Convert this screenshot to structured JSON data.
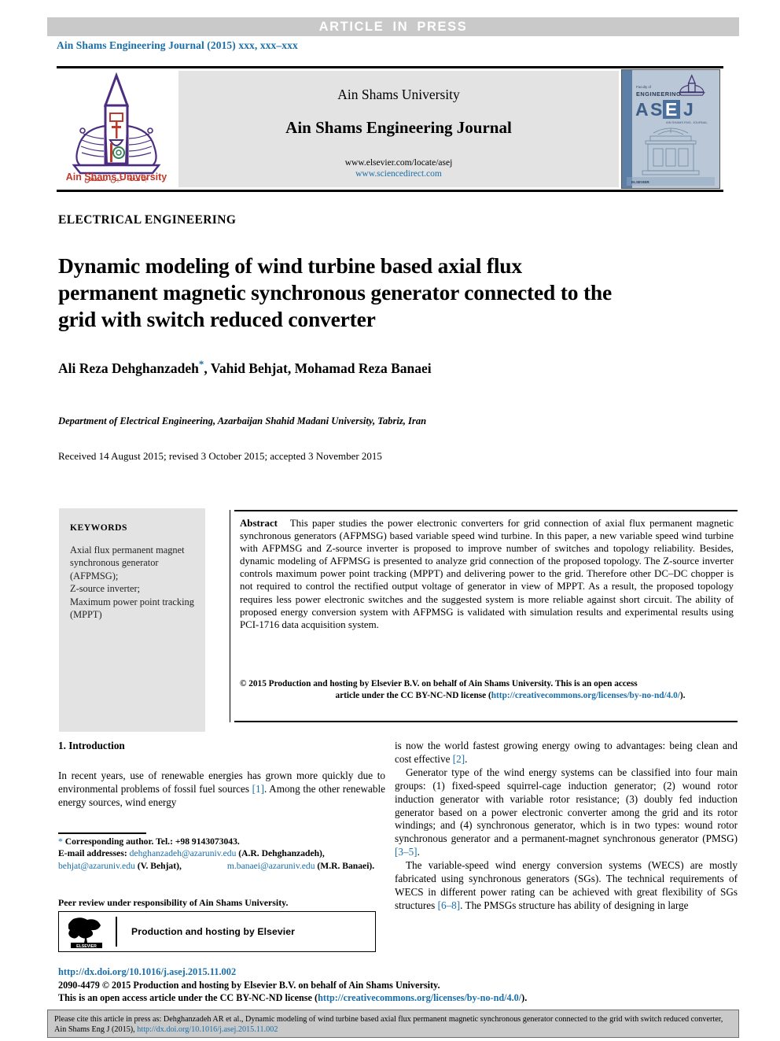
{
  "banner": {
    "article_in_press": "ARTICLE  IN  PRESS"
  },
  "journal_ref": "Ain Shams Engineering Journal (2015) xxx, xxx–xxx",
  "masthead": {
    "university": "Ain Shams University",
    "journal_name": "Ain Shams Engineering Journal",
    "url_elsevier": "www.elsevier.com/locate/asej",
    "url_sciencedirect": "www.sciencedirect.com",
    "logo_alt": "Ain Shams University",
    "logo_label_en": "Ain Shams University",
    "cover_title_small": "Faculty of",
    "cover_title": "ENGINEERING",
    "cover_acronym": "ASEJ",
    "cover_subtitle": "AIN SHAMS ENGINEERING JOURNAL"
  },
  "article": {
    "kicker": "ELECTRICAL ENGINEERING",
    "title": "Dynamic modeling of wind turbine based axial flux permanent magnetic synchronous generator connected to the grid with switch reduced converter",
    "authors": "Ali Reza Dehghanzadeh",
    "authors_rest": ", Vahid Behjat, Mohamad Reza Banaei",
    "corresponding_mark": "*",
    "affiliation": "Department of Electrical Engineering, Azarbaijan Shahid Madani University, Tabriz, Iran",
    "received": "Received 14 August 2015; revised 3 October 2015; accepted 3 November 2015"
  },
  "keywords": {
    "heading": "KEYWORDS",
    "items": [
      "Axial flux permanent magnet synchronous generator (AFPMSG);",
      "Z-source inverter;",
      "Maximum power point tracking (MPPT)"
    ]
  },
  "abstract": {
    "label": "Abstract",
    "text": "This paper studies the power electronic converters for grid connection of axial flux permanent magnetic synchronous generators (AFPMSG) based variable speed wind turbine. In this paper, a new variable speed wind turbine with AFPMSG and Z-source inverter is proposed to improve number of switches and topology reliability. Besides, dynamic modeling of AFPMSG is presented to analyze grid connection of the proposed topology. The Z-source inverter controls maximum power point tracking (MPPT) and delivering power to the grid. Therefore other DC–DC chopper is not required to control the rectified output voltage of generator in view of MPPT. As a result, the proposed topology requires less power electronic switches and the suggested system is more reliable against short circuit. The ability of proposed energy conversion system with AFPMSG is validated with simulation results and experimental results using PCI-1716 data acquisition system.",
    "copyright_line1": "© 2015 Production and hosting by Elsevier B.V. on behalf of Ain Shams University. This is an open access",
    "copyright_line2_pre": "article under the CC BY-NC-ND license (",
    "copyright_license_url": "http://creativecommons.org/licenses/by-no-nd/4.0/",
    "copyright_line2_post": ")."
  },
  "body": {
    "section_heading": "1. Introduction",
    "left_paragraph_1_a": "In recent years, use of renewable energies has grown more quickly due to environmental problems of fossil fuel sources ",
    "left_paragraph_1_ref": "[1]",
    "left_paragraph_1_b": ". Among the other renewable energy sources, wind energy",
    "right_paragraph_1_a": "is now the world fastest growing energy owing to advantages: being clean and cost effective ",
    "right_paragraph_1_ref": "[2]",
    "right_paragraph_1_b": ".",
    "right_paragraph_2": "Generator type of the wind energy systems can be classified into four main groups: (1) fixed-speed squirrel-cage induction generator; (2) wound rotor induction generator with variable rotor resistance; (3) doubly fed induction generator based on a power electronic converter among the grid and its rotor windings; and (4) synchronous generator, which is in two types: wound rotor synchronous generator and a permanent-magnet synchronous generator (PMSG) ",
    "right_paragraph_2_ref": "[3–5]",
    "right_paragraph_2_end": ".",
    "right_paragraph_3": "The variable-speed wind energy conversion systems (WECS) are mostly fabricated using synchronous generators (SGs). The technical requirements of WECS in different power rating can be achieved with great flexibility of SGs structures ",
    "right_paragraph_3_ref": "[6–8]",
    "right_paragraph_3_end": ". The PMSGs structure has ability of designing in large"
  },
  "footnote": {
    "corresponding": "Corresponding author. Tel.: +98 9143073043.",
    "email_label": "E-mail addresses:",
    "email_1": "dehghanzadeh@azaruniv.edu",
    "email_1_owner": " (A.R. Dehghanzadeh),",
    "email_2": "behjat@azaruniv.edu",
    "email_2_owner": "  (V.   Behjat),",
    "email_3": "m.banaei@azaruniv.edu",
    "email_3_owner": "(M.R. Banaei).",
    "peer_review": "Peer review under responsibility of Ain Shams University."
  },
  "elsevier": {
    "text": "Production and hosting by Elsevier",
    "wordmark": "ELSEVIER"
  },
  "footer": {
    "doi": "http://dx.doi.org/10.1016/j.asej.2015.11.002",
    "issn_line": "2090-4479 © 2015 Production and hosting by Elsevier B.V. on behalf of Ain Shams University.",
    "license_pre": "This is an open access article under the CC BY-NC-ND license (",
    "license_url": "http://creativecommons.org/licenses/by-no-nd/4.0/",
    "license_post": ")."
  },
  "cite_footer": {
    "text_a": "Please cite this article in press as: Dehghanzadeh AR et al., Dynamic modeling of wind turbine based axial flux permanent magnetic synchronous generator connected to the grid with switch reduced converter, Ain Shams Eng J (2015), ",
    "url": "http://dx.doi.org/10.1016/j.asej.2015.11.002"
  },
  "colors": {
    "link_blue": "#1a6ea8",
    "banner_gray": "#c9c9c9",
    "panel_gray": "#e3e3e3",
    "logo_purple": "#4b2d7f",
    "logo_red": "#c0392b"
  }
}
